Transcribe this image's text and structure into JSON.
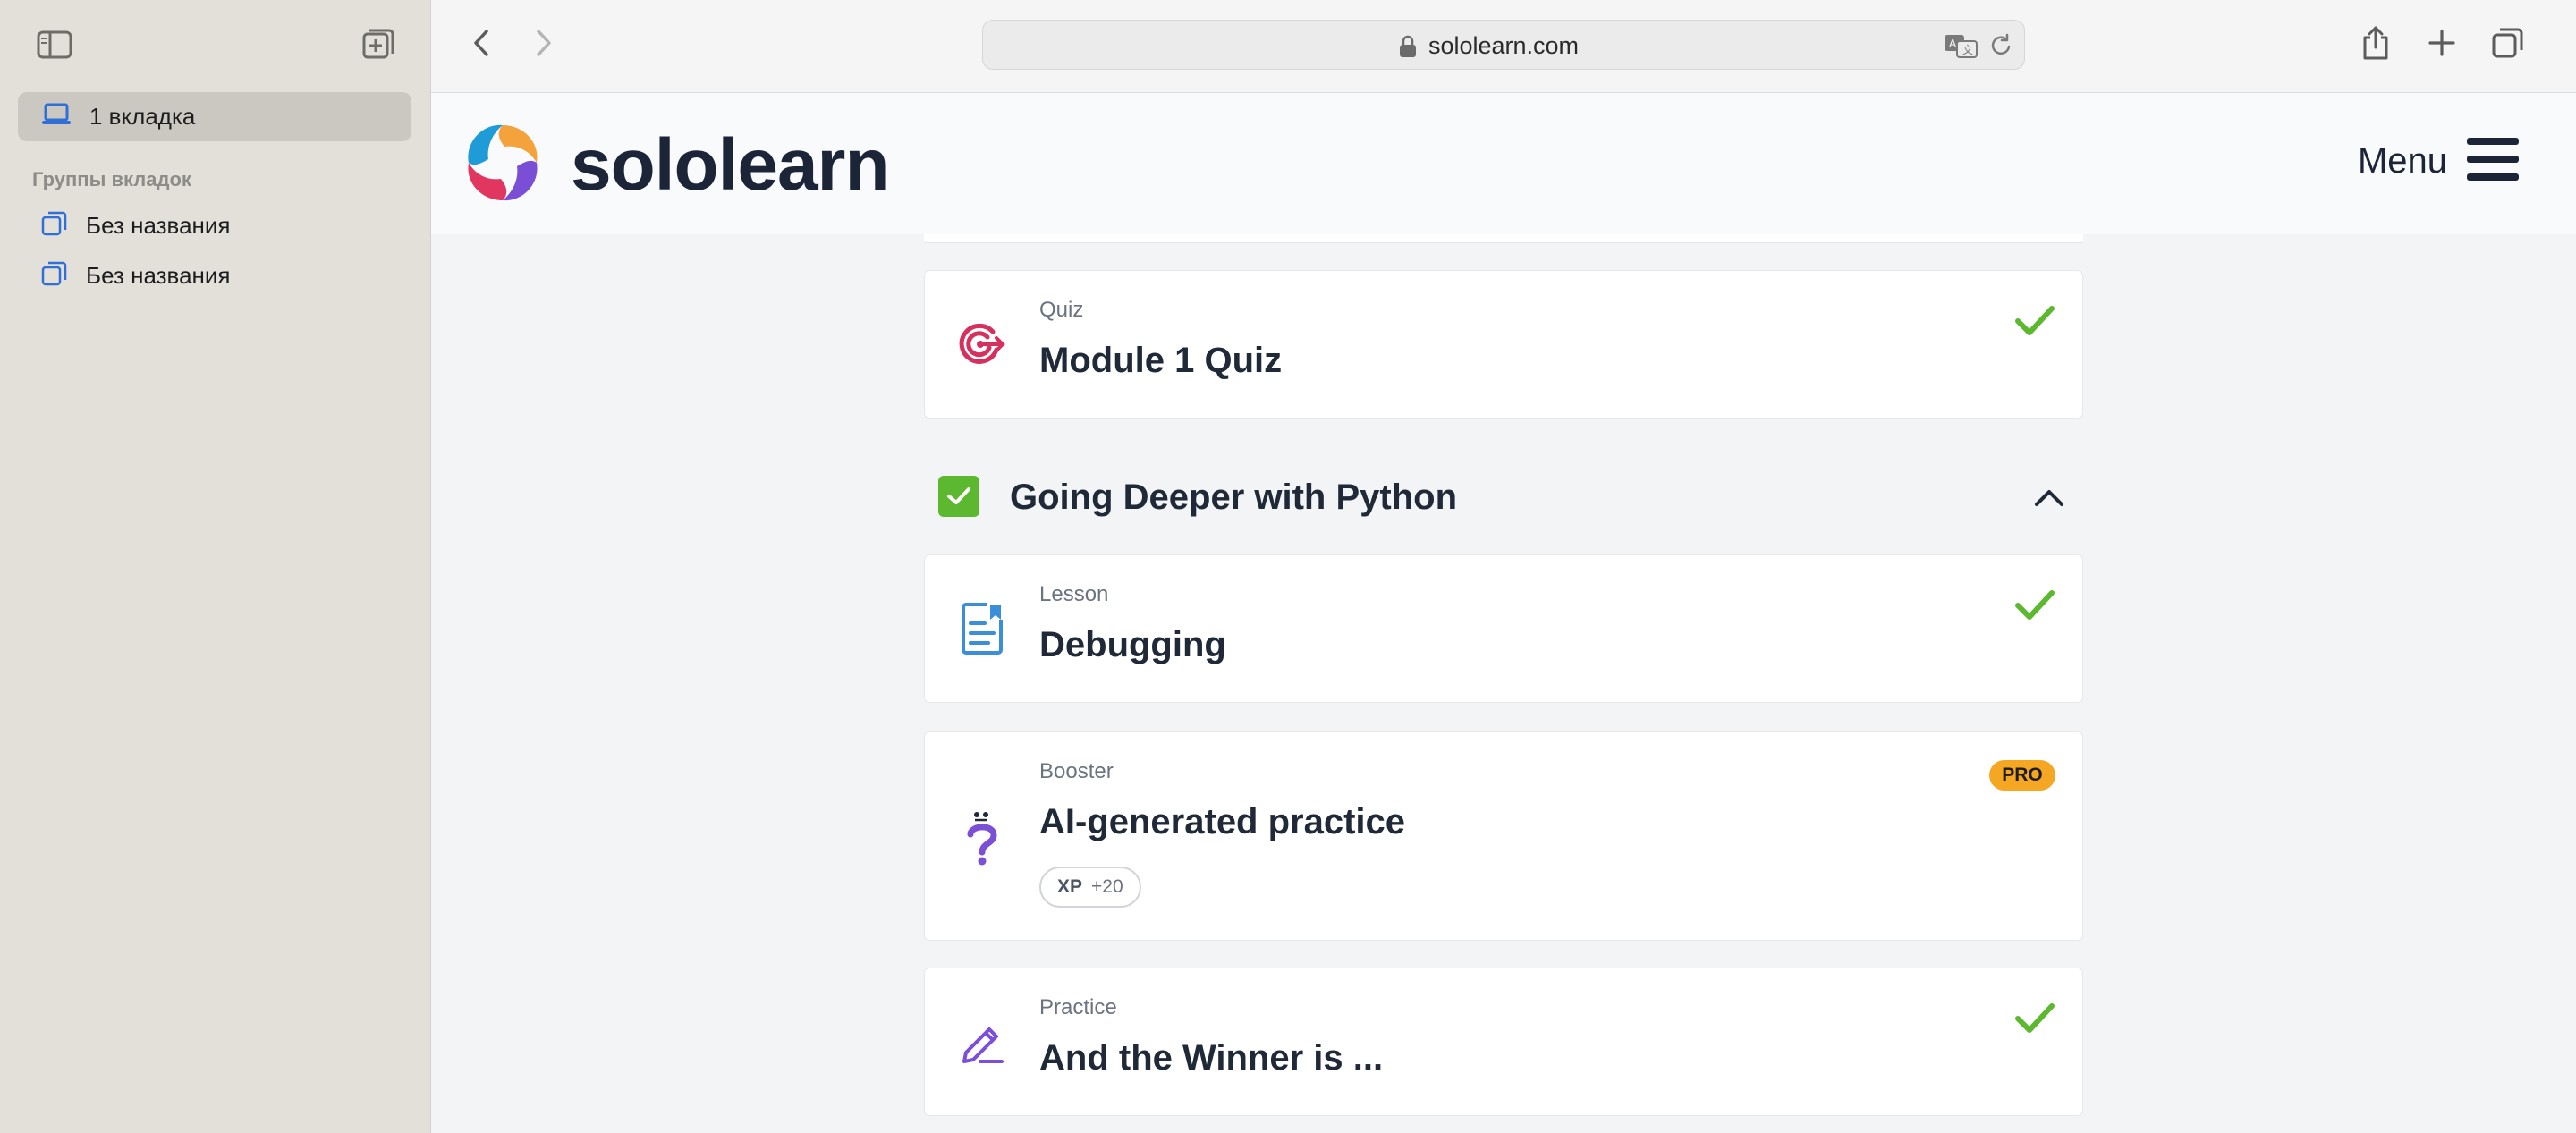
{
  "browser": {
    "sidebar": {
      "active_tab_label": "1 вкладка",
      "section_title": "Группы вкладок",
      "groups": [
        "Без названия",
        "Без названия"
      ]
    },
    "url": "sololearn.com",
    "icons": {
      "sidebar_toggle": "sidebar-toggle-icon",
      "new_tab_group": "new-tab-group-icon",
      "back": "chevron-left-icon",
      "forward": "chevron-right-icon",
      "lock": "lock-icon",
      "translate": "translate-icon",
      "reload": "reload-icon",
      "share": "share-icon",
      "new_tab": "plus-icon",
      "tab_overview": "tab-overview-icon"
    }
  },
  "site": {
    "logo_text": "sololearn",
    "menu_label": "Menu"
  },
  "course": {
    "quiz": {
      "kind": "Quiz",
      "title": "Module 1 Quiz",
      "completed": true
    },
    "module": {
      "title": "Going Deeper with Python",
      "completed": true,
      "expanded": true
    },
    "items": [
      {
        "kind": "Lesson",
        "title": "Debugging",
        "completed": true
      },
      {
        "kind": "Booster",
        "title": "AI-generated practice",
        "badge": "PRO",
        "xp_label": "XP",
        "xp_value": "+20"
      },
      {
        "kind": "Practice",
        "title": "And the Winner is ...",
        "completed": true
      }
    ]
  },
  "colors": {
    "check_green": "#5cb82e",
    "pro_badge": "#f5a623",
    "quiz_icon": "#d6305e",
    "lesson_icon": "#3b8fd8",
    "booster_icon": "#7b4fd6"
  }
}
